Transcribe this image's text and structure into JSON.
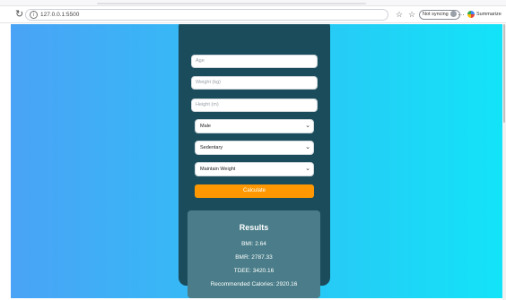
{
  "browser": {
    "url": "127.0.0.1:5500",
    "sync_label": "Not syncing",
    "summarize_label": "Summarize"
  },
  "form": {
    "age_placeholder": "Age",
    "weight_placeholder": "Weight (kg)",
    "height_placeholder": "Height (m)",
    "gender_selected": "Male",
    "activity_selected": "Sedentary",
    "goal_selected": "Maintain Weight",
    "calculate_label": "Calculate"
  },
  "results": {
    "title": "Results",
    "bmi": "BMI: 2.64",
    "bmr": "BMR: 2787.33",
    "tdee": "TDEE: 3420.16",
    "recommended": "Recommended Calories: 2920.16"
  },
  "colors": {
    "bg_gradient_start": "#4aa3f6",
    "bg_gradient_end": "#12e4f8",
    "card": "#1a4c5c",
    "results_panel": "#4a7d89",
    "button": "#ff9800"
  }
}
